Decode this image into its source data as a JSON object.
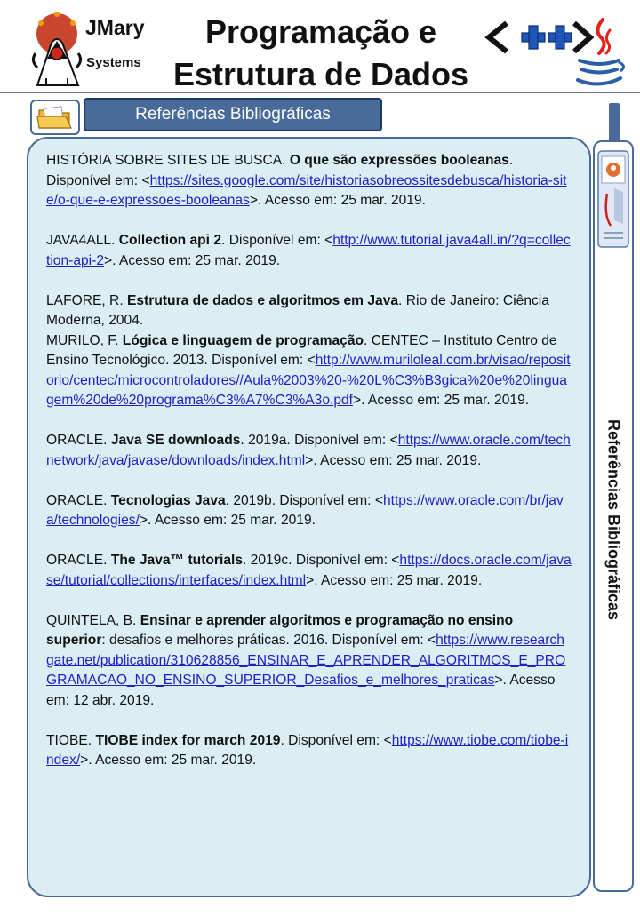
{
  "header": {
    "brand_name": "JMary",
    "brand_sub": "Systems",
    "title_line1": "Programação e",
    "title_line2": "Estrutura de Dados"
  },
  "section": {
    "label": "Referências Bibliográficas",
    "side_label": "Referências Bibliográficas"
  },
  "colors": {
    "accent": "#4a6a9a",
    "box_bg": "#dbeef4",
    "link": "#1f1fc4"
  },
  "references": [
    {
      "author": "HISTÓRIA SOBRE SITES DE BUSCA.",
      "title": "O que são expressões booleanas",
      "middle": ". Disponível em:",
      "url": "https://sites.google.com/site/historiasobreossitesdebusca/historia-site/o-que-e-expressoes-booleanas",
      "access": "Acesso em: 25 mar. 2019."
    },
    {
      "author": "JAVA4ALL.",
      "title": "Collection api 2",
      "middle": ". Disponível em:",
      "url": "http://www.tutorial.java4all.in/?q=collection-api-2",
      "access": "Acesso em: 25 mar. 2019."
    },
    {
      "author": "LAFORE, R.",
      "title": "Estrutura de dados e algoritmos em Java",
      "middle": ". Rio de Janeiro: Ciência Moderna, 2004."
    },
    {
      "author": "MURILO, F.",
      "title": "Lógica e linguagem de programação",
      "middle": ". CENTEC – Instituto Centro de Ensino Tecnológico. 2013. Disponível em:",
      "url": "http://www.muriloleal.com.br/visao/repositorio/centec/microcontroladores//Aula%2003%20-%20L%C3%B3gica%20e%20linguagem%20de%20programa%C3%A7%C3%A3o.pdf",
      "access": "Acesso em: 25 mar. 2019."
    },
    {
      "author": "ORACLE.",
      "title": "Java SE downloads",
      "middle": ". 2019a. Disponível em:",
      "url": "https://www.oracle.com/technetwork/java/javase/downloads/index.html",
      "access": "Acesso em: 25 mar. 2019."
    },
    {
      "author": "ORACLE.",
      "title": "Tecnologias Java",
      "middle": ". 2019b. Disponível em:",
      "url": "https://www.oracle.com/br/java/technologies/",
      "access": "Acesso em: 25 mar. 2019."
    },
    {
      "author": "ORACLE.",
      "title": "The Java™ tutorials",
      "middle": ". 2019c. Disponível em:",
      "url": "https://docs.oracle.com/javase/tutorial/collections/interfaces/index.html",
      "access": "Acesso em: 25 mar. 2019."
    },
    {
      "author": "QUINTELA, B.",
      "title": "Ensinar e aprender algoritmos e programação no ensino superior",
      "middle": ": desafios e melhores práticas. 2016. Disponível em:",
      "url": "https://www.researchgate.net/publication/310628856_ENSINAR_E_APRENDER_ALGORITMOS_E_PROGRAMACAO_NO_ENSINO_SUPERIOR_Desafios_e_melhores_praticas",
      "access": "Acesso em: 12 abr. 2019."
    },
    {
      "author": "TIOBE.",
      "title": "TIOBE index for march 2019",
      "middle": ". Disponível em:",
      "url": "https://www.tiobe.com/tiobe-index/",
      "access": "Acesso em: 25 mar. 2019."
    }
  ]
}
